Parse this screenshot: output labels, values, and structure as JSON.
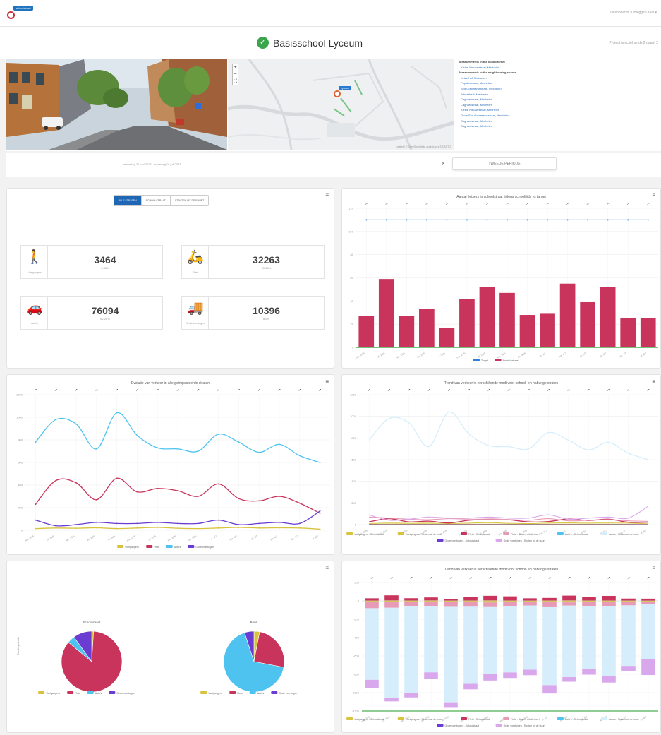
{
  "header": {
    "logo_text": "schoolstraat",
    "nav_text": "Dashboards ▾   Inloggen   Taal ▾"
  },
  "title": {
    "school_name": "Basisschool Lyceum",
    "project_info": "Project is actief sinds 2 maart 2"
  },
  "map": {
    "zoom_in": "+",
    "zoom_out": "−",
    "fullscreen": "⛶",
    "marker_label": "Lyceum",
    "attribution": "Leaflet | © OpenStreetMap contributors © CARTO"
  },
  "links": {
    "heading_schoolstreet": "Measurements in the schoolstreet",
    "schoolstreet": [
      "Kleine Nieuwestraat, Mechelen"
    ],
    "heading_neighbouring": "Measurements in the neighbouring streets",
    "neighbouring": [
      "Keizerhof, Mechelen",
      "Populierstraat, Mechelen",
      "Sint-Gommarusstraat, Mechelen",
      "Winketkaai, Mechelen",
      "Cagnardstraat, Mechelen",
      "Cagnardstraat, Mechelen",
      "Kleine Nieuwestraat, Mechelen",
      "Oude Sint-Gommarusstraat, Mechelen",
      "Cagnardstraat, Mechelen",
      "Cagnardstraat, Mechelen"
    ]
  },
  "period": {
    "date_range": "maandag 20 juni 2022 - maandag 18 juli 2022",
    "close": "×",
    "button": "TWEEDE PERIODE"
  },
  "summary": {
    "segments": [
      "ALLE STRATEN",
      "SCHOOLSTRAAT",
      "STRATEN UIT DE BUURT"
    ],
    "active_segment": "ALLE STRATEN",
    "menu": "≡",
    "kpis": [
      {
        "label": "Voetgangers",
        "value": "3464",
        "pct": "2.85%",
        "icon": "pedestrian-icon"
      },
      {
        "label": "Fiets",
        "value": "32263",
        "pct": "26.45%",
        "icon": "bicycle-icon"
      },
      {
        "label": "Auto's",
        "value": "76094",
        "pct": "62.26%",
        "icon": "car-icon"
      },
      {
        "label": "Grote voertuigen",
        "value": "10396",
        "pct": "8.5%",
        "icon": "truck-icon"
      }
    ]
  },
  "colors": {
    "pedestrian": "#d8c33c",
    "bike": "#c8345b",
    "car": "#4fc3f0",
    "heavy": "#6a3cd2",
    "target": "#2a82dd",
    "green": "#4caf50",
    "car_light": "#d6eefb",
    "bike_light": "#e79bb6",
    "heavy_light": "#d9a8ec",
    "active": "#1f66b5"
  },
  "chart_data": [
    {
      "type": "bar",
      "title": "Aantal fietsers in schoolstraat tijdens schooltijds vs target",
      "menu": "≡",
      "ylim": [
        0,
        120
      ],
      "yticks": [
        "0",
        "20",
        "40",
        "60",
        "80",
        "100",
        "120"
      ],
      "categories": [
        "ma. 20/6",
        "di. 21/6",
        "wo. 22/6",
        "do. 23/6",
        "vr. 24/6",
        "ma. 27/6",
        "di. 28/6",
        "wo. 29/6",
        "do. 30/6",
        "vr. 1/7",
        "ma. 4/7",
        "di. 5/7",
        "wo. 6/7",
        "do. 7/7",
        "vr. 8/7"
      ],
      "series": [
        {
          "name": "Target",
          "type": "line",
          "values": [
            110,
            110,
            110,
            110,
            110,
            110,
            110,
            110,
            110,
            110,
            110,
            110,
            110,
            110,
            110
          ]
        },
        {
          "name": "Aantal fietsers",
          "type": "bar",
          "values": [
            27,
            59,
            27,
            33,
            17,
            42,
            52,
            47,
            28,
            29,
            55,
            39,
            52,
            25,
            25
          ]
        }
      ],
      "legend": "bottom"
    },
    {
      "type": "line",
      "title": "Evolutie van verkeer in alle geïmpacteerde straten",
      "menu": "≡",
      "ylim": [
        0,
        1200
      ],
      "yticks": [
        "0",
        "200",
        "400",
        "600",
        "800",
        "1000",
        "1200"
      ],
      "categories": [
        "ma. 20/6",
        "di. 21/6",
        "wo. 22/6",
        "do. 23/6",
        "vr. 24/6",
        "ma. 27/6",
        "di. 28/6",
        "wo. 29/6",
        "do. 30/6",
        "vr. 1/7",
        "ma. 4/7",
        "di. 5/7",
        "wo. 6/7",
        "do. 7/7",
        "vr. 8/7"
      ],
      "series": [
        {
          "name": "Voetgangers",
          "values": [
            15,
            20,
            18,
            22,
            15,
            20,
            25,
            18,
            15,
            20,
            25,
            20,
            22,
            20,
            10
          ]
        },
        {
          "name": "Fiets",
          "values": [
            230,
            440,
            420,
            270,
            460,
            340,
            370,
            350,
            300,
            410,
            280,
            260,
            300,
            240,
            150
          ]
        },
        {
          "name": "Auto's",
          "values": [
            780,
            980,
            940,
            720,
            1040,
            840,
            730,
            720,
            700,
            850,
            780,
            690,
            760,
            660,
            600
          ]
        },
        {
          "name": "Grote voertuigen",
          "values": [
            90,
            40,
            50,
            70,
            60,
            60,
            70,
            60,
            60,
            90,
            50,
            60,
            70,
            60,
            170
          ]
        }
      ],
      "legend": "bottom"
    },
    {
      "type": "line",
      "title": "Trend van verkeer in verschillende modi voor school- en naburige straten",
      "menu": "≡",
      "ylim": [
        0,
        1200
      ],
      "yticks": [
        "0",
        "200",
        "400",
        "600",
        "800",
        "1000",
        "1200"
      ],
      "categories": [
        "ma. 20/6",
        "di. 21/6",
        "wo. 22/6",
        "do. 23/6",
        "vr. 24/6",
        "ma. 27/6",
        "di. 28/6",
        "wo. 29/6",
        "do. 30/6",
        "vr. 1/7",
        "ma. 4/7",
        "di. 5/7",
        "wo. 6/7",
        "do. 7/7",
        "vr. 8/7"
      ],
      "series": [
        {
          "name": "Voetgangers - Schoolstraat",
          "values": [
            3,
            5,
            4,
            5,
            3,
            4,
            5,
            4,
            3,
            4,
            5,
            4,
            4,
            3,
            2
          ]
        },
        {
          "name": "Voetgangers - Straten uit de buurt",
          "values": [
            10,
            15,
            12,
            14,
            10,
            14,
            18,
            12,
            10,
            14,
            16,
            14,
            15,
            14,
            8
          ]
        },
        {
          "name": "Fiets - Schoolstraat",
          "values": [
            25,
            55,
            25,
            32,
            15,
            40,
            50,
            45,
            25,
            28,
            52,
            38,
            50,
            22,
            22
          ]
        },
        {
          "name": "Fiets - Straten uit de buurt",
          "values": [
            70,
            60,
            50,
            45,
            55,
            50,
            50,
            48,
            40,
            55,
            35,
            40,
            45,
            35,
            30
          ]
        },
        {
          "name": "Auto's - Schoolstraat",
          "values": [
            0,
            0,
            0,
            0,
            0,
            0,
            0,
            0,
            0,
            0,
            0,
            0,
            0,
            0,
            0
          ]
        },
        {
          "name": "Auto's - Straten uit de buurt",
          "values": [
            780,
            980,
            940,
            720,
            1040,
            840,
            730,
            720,
            700,
            850,
            780,
            690,
            760,
            660,
            600
          ]
        },
        {
          "name": "Grote voertuigen - Schoolstraat",
          "values": [
            0,
            0,
            0,
            0,
            0,
            0,
            0,
            0,
            0,
            0,
            0,
            0,
            0,
            0,
            0
          ]
        },
        {
          "name": "Grote voertuigen - Straten uit de buurt",
          "values": [
            90,
            40,
            50,
            70,
            60,
            60,
            70,
            60,
            60,
            90,
            50,
            60,
            70,
            60,
            170
          ]
        }
      ],
      "legend": "bottom"
    },
    {
      "type": "pie",
      "menu": "≡",
      "yaxis_label": "Eerste periode",
      "pies": [
        {
          "title": "Schoolstraat",
          "labels": [
            "Voetgangers",
            "Fiets",
            "Auto's",
            "Grote voertuigen"
          ],
          "values": [
            1,
            85,
            4,
            10
          ]
        },
        {
          "title": "Buurt",
          "labels": [
            "Voetgangers",
            "Fiets",
            "Auto's",
            "Grote voertuigen"
          ],
          "values": [
            3,
            25,
            67,
            5
          ]
        }
      ],
      "legend": "bottom"
    },
    {
      "type": "bar",
      "stacked": true,
      "title": "Trend van verkeer in verschillende modi voor school- en naburige straten",
      "menu": "≡",
      "ylim": [
        -1200,
        200
      ],
      "yticks": [
        "-1200",
        "-1000",
        "-800",
        "-600",
        "-400",
        "-200",
        "0",
        "200"
      ],
      "categories": [
        "ma. 20/6",
        "di. 21/6",
        "wo. 22/6",
        "do. 23/6",
        "vr. 24/6",
        "ma. 27/6",
        "di. 28/6",
        "wo. 29/6",
        "do. 30/6",
        "vr. 1/7",
        "ma. 4/7",
        "di. 5/7",
        "wo. 6/7",
        "do. 7/7",
        "vr. 8/7"
      ],
      "series": [
        {
          "name": "Voetgangers - Schoolstraat",
          "values": [
            3,
            5,
            4,
            5,
            3,
            4,
            5,
            4,
            3,
            4,
            5,
            4,
            4,
            3,
            2
          ]
        },
        {
          "name": "Voetgangers - Straten uit de buurt",
          "values": [
            -10,
            -15,
            -12,
            -14,
            -10,
            -14,
            -18,
            -12,
            -10,
            -14,
            -16,
            -14,
            -15,
            -14,
            -8
          ]
        },
        {
          "name": "Fiets - Schoolstraat",
          "values": [
            25,
            55,
            25,
            32,
            15,
            40,
            50,
            45,
            25,
            28,
            52,
            38,
            50,
            22,
            22
          ]
        },
        {
          "name": "Fiets - Straten uit de buurt",
          "values": [
            -70,
            -60,
            -50,
            -45,
            -55,
            -50,
            -50,
            -48,
            -40,
            -55,
            -35,
            -40,
            -45,
            -35,
            -30
          ]
        },
        {
          "name": "Auto's - Schoolstraat",
          "values": [
            0,
            0,
            0,
            0,
            0,
            0,
            0,
            0,
            0,
            0,
            0,
            0,
            0,
            0,
            0
          ]
        },
        {
          "name": "Auto's - Straten uit de buurt",
          "values": [
            -780,
            -980,
            -940,
            -720,
            -1040,
            -840,
            -730,
            -720,
            -700,
            -850,
            -780,
            -690,
            -760,
            -660,
            -600
          ]
        },
        {
          "name": "Grote voertuigen - Schoolstraat",
          "values": [
            0,
            0,
            0,
            0,
            0,
            0,
            0,
            0,
            0,
            0,
            0,
            0,
            0,
            0,
            0
          ]
        },
        {
          "name": "Grote voertuigen - Straten uit de buurt",
          "values": [
            -90,
            -40,
            -50,
            -70,
            -60,
            -60,
            -70,
            -60,
            -60,
            -90,
            -50,
            -60,
            -70,
            -60,
            -170
          ]
        }
      ],
      "legend": "bottom"
    }
  ]
}
